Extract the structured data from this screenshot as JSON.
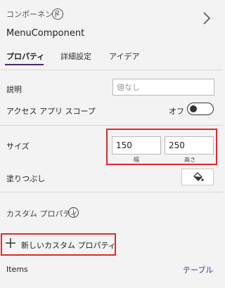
{
  "header": {
    "label": "コンポーネント",
    "help_glyph": "?",
    "component_name": "MenuComponent",
    "chevron_icon": "chevron-right-icon"
  },
  "tabs": [
    {
      "label": "プロパティ",
      "selected": true
    },
    {
      "label": "詳細設定",
      "selected": false
    },
    {
      "label": "アイデア",
      "selected": false
    }
  ],
  "properties": {
    "description": {
      "label": "説明",
      "placeholder": "値なし",
      "value": ""
    },
    "access_app_scope": {
      "label": "アクセス アプリ スコープ",
      "state_label": "オフ",
      "on": false
    },
    "size": {
      "label": "サイズ",
      "width_value": "150",
      "width_caption": "幅",
      "height_value": "250",
      "height_caption": "高さ"
    },
    "fill": {
      "label": "塗りつぶし",
      "icon": "paint-bucket-icon"
    }
  },
  "custom_properties": {
    "section_label": "カスタム プロパティ",
    "info_icon": "info-icon",
    "new_button_label": "新しいカスタム プロパティ",
    "items": [
      {
        "name": "Items",
        "type": "テーブル"
      }
    ]
  },
  "colors": {
    "highlight": "#e0282f",
    "accent": "#5a2a82"
  }
}
